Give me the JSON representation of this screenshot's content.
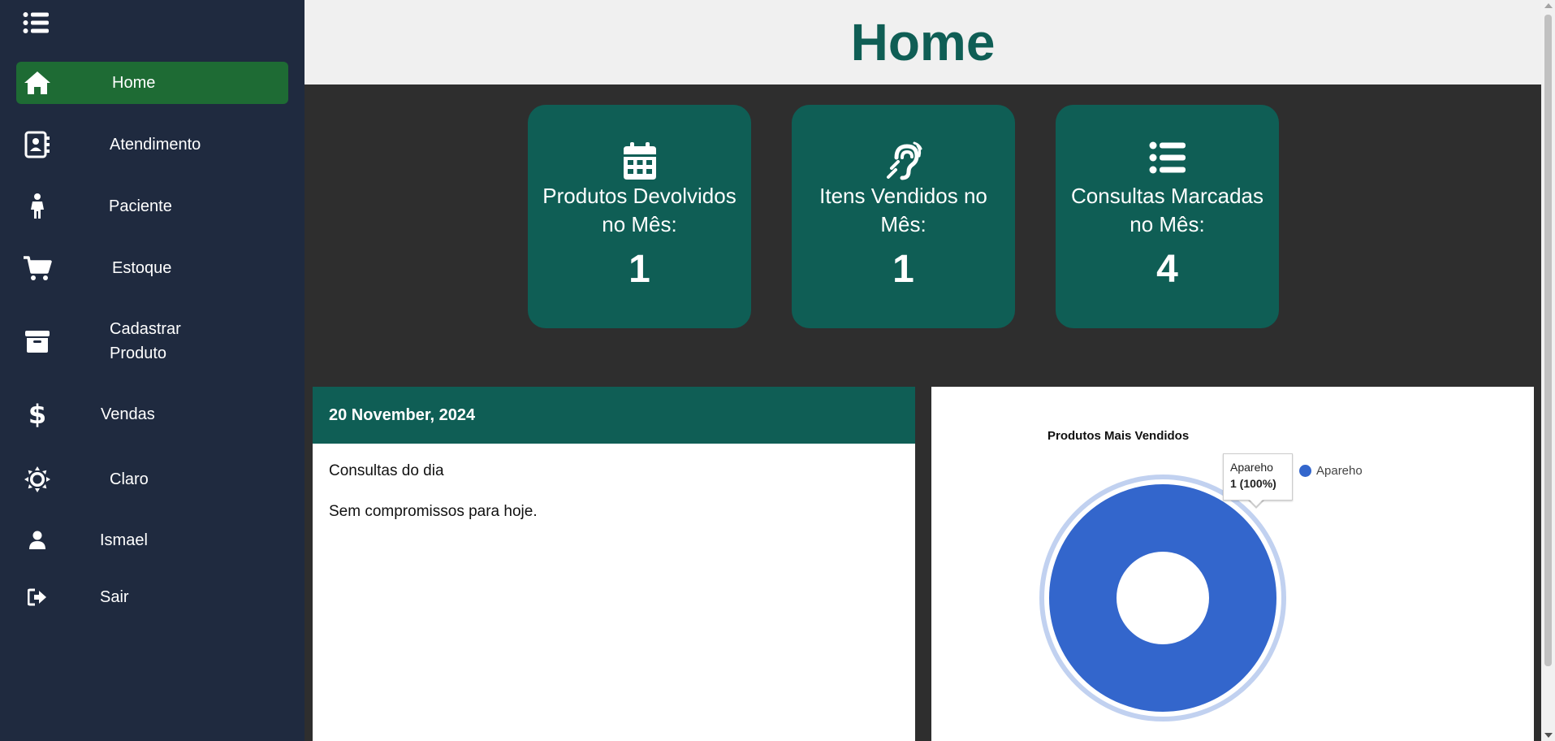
{
  "sidebar": {
    "menu_icon": "list-icon",
    "items": [
      {
        "label": "Home",
        "icon": "home-icon",
        "active": true
      },
      {
        "label": "Atendimento",
        "icon": "contact-book-icon"
      },
      {
        "label": "Paciente",
        "icon": "person-icon"
      },
      {
        "label": "Estoque",
        "icon": "cart-icon"
      },
      {
        "label": "Cadastrar Produto",
        "icon": "archive-box-icon"
      },
      {
        "label": "Vendas",
        "icon": "dollar-icon"
      },
      {
        "label": "Claro",
        "icon": "sun-icon"
      },
      {
        "label": "Ismael",
        "icon": "user-icon"
      },
      {
        "label": "Sair",
        "icon": "sign-out-icon"
      }
    ]
  },
  "header": {
    "title": "Home"
  },
  "cards": [
    {
      "title": "Produtos Devolvidos no Mês:",
      "value": "1",
      "icon": "calendar-icon"
    },
    {
      "title": "Itens Vendidos no Mês:",
      "value": "1",
      "icon": "hearing-icon"
    },
    {
      "title": "Consultas Marcadas no Mês:",
      "value": "4",
      "icon": "list-icon"
    }
  ],
  "calendar": {
    "date": "20 November, 2024",
    "heading": "Consultas do dia",
    "message": "Sem compromissos para hoje."
  },
  "chart_data": {
    "type": "pie",
    "title": "Produtos Mais Vendidos",
    "categories": [
      "Apareho"
    ],
    "values": [
      1
    ],
    "colors": [
      "#3366cc"
    ],
    "legend": "right",
    "tooltip": {
      "label": "Apareho",
      "value": "1 (100%)"
    }
  },
  "colors": {
    "sidebar_bg": "#1f2a3f",
    "active_item": "#1e6b34",
    "card_bg": "#0f5e55",
    "accent": "#0f5e55",
    "page_bg": "#2e2e2e"
  }
}
